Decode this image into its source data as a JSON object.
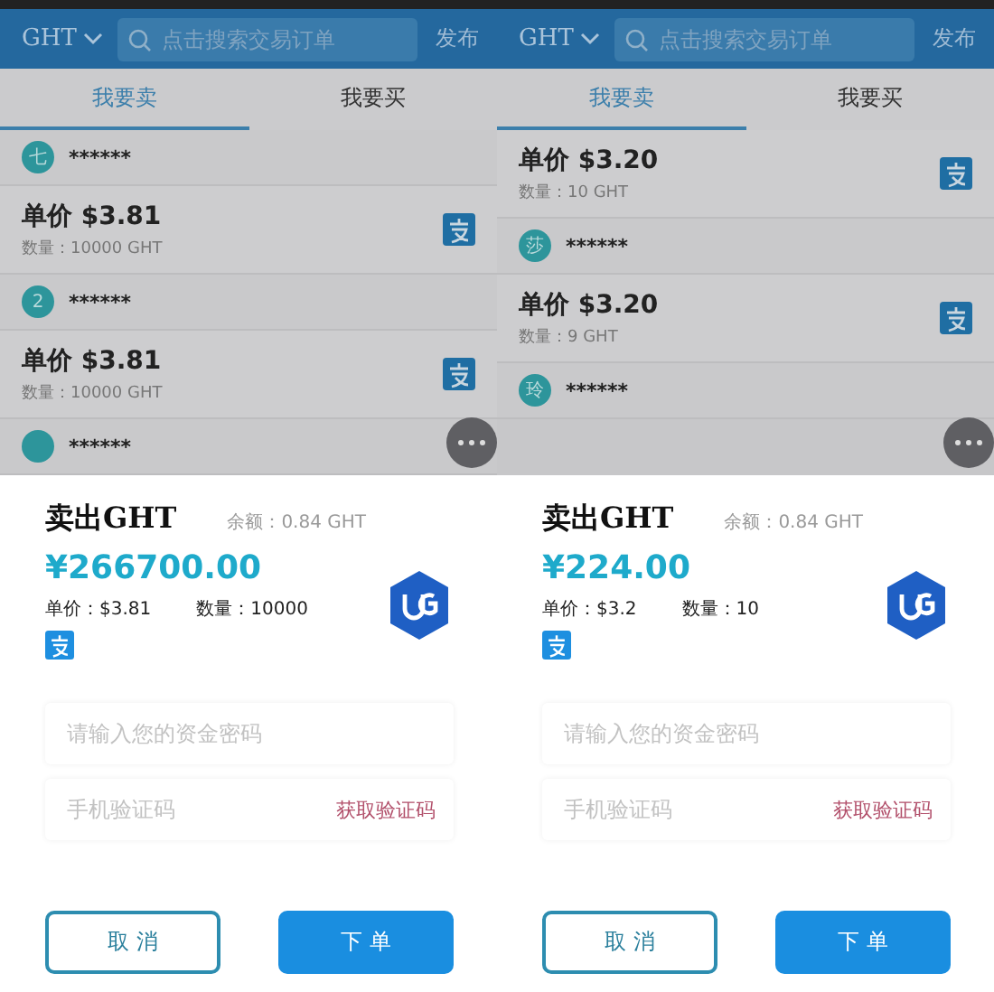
{
  "panels": [
    {
      "header": {
        "currency": "GHT",
        "search_placeholder": "点击搜索交易订单",
        "publish": "发布"
      },
      "tabs": [
        {
          "label": "我要卖",
          "selected": true
        },
        {
          "label": "我要买",
          "selected": false
        }
      ],
      "list": [
        {
          "kind": "user",
          "avatar": "七",
          "name": "******"
        },
        {
          "kind": "order",
          "price": "单价 $3.81",
          "quantity": "数量：10000 GHT"
        },
        {
          "kind": "user",
          "avatar": "2",
          "name": "******"
        },
        {
          "kind": "order",
          "price": "单价 $3.81",
          "quantity": "数量：10000 GHT"
        },
        {
          "kind": "user",
          "name": "******"
        }
      ],
      "sheet": {
        "title": "卖出GHT",
        "balance": "余额：0.84 GHT",
        "amount": "¥266700.00",
        "unit_price": "单价：$3.81",
        "quantity": "数量：10000",
        "password_placeholder": "请输入您的资金密码",
        "code_placeholder": "手机验证码",
        "get_code": "获取验证码",
        "buttons": [
          {
            "label": "取 消",
            "kind": "outline"
          },
          {
            "label": "下 单",
            "kind": "primary"
          }
        ]
      }
    },
    {
      "header": {
        "currency": "GHT",
        "search_placeholder": "点击搜索交易订单",
        "publish": "发布"
      },
      "tabs": [
        {
          "label": "我要卖",
          "selected": true
        },
        {
          "label": "我要买",
          "selected": false
        }
      ],
      "list": [
        {
          "kind": "order",
          "price": "单价 $3.20",
          "quantity": "数量：10 GHT"
        },
        {
          "kind": "user",
          "avatar": "莎",
          "name": "******"
        },
        {
          "kind": "order",
          "price": "单价 $3.20",
          "quantity": "数量：9 GHT"
        },
        {
          "kind": "user",
          "avatar": "玲",
          "name": "******"
        }
      ],
      "sheet": {
        "title": "卖出GHT",
        "balance": "余额：0.84 GHT",
        "amount": "¥224.00",
        "unit_price": "单价：$3.2",
        "quantity": "数量：10",
        "password_placeholder": "请输入您的资金密码",
        "code_placeholder": "手机验证码",
        "get_code": "获取验证码",
        "buttons": [
          {
            "label": "取 消",
            "kind": "outline"
          },
          {
            "label": "下 单",
            "kind": "primary"
          }
        ]
      }
    }
  ]
}
